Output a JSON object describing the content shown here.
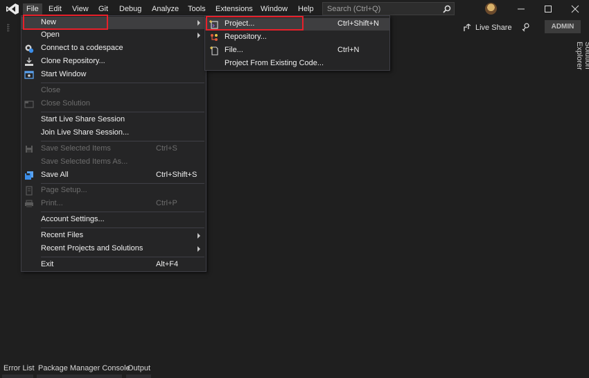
{
  "menubar": {
    "items": [
      "File",
      "Edit",
      "View",
      "Git",
      "Debug",
      "Analyze",
      "Tools",
      "Extensions",
      "Window",
      "Help"
    ],
    "search_placeholder": "Search (Ctrl+Q)"
  },
  "toolbar": {
    "live_share": "Live Share",
    "admin": "ADMIN"
  },
  "side_panel": {
    "solution_explorer": "Solution Explorer"
  },
  "file_menu": {
    "items": [
      {
        "label": "New",
        "shortcut": ""
      },
      {
        "label": "Open",
        "shortcut": ""
      },
      {
        "label": "Connect to a codespace",
        "shortcut": ""
      },
      {
        "label": "Clone Repository...",
        "shortcut": ""
      },
      {
        "label": "Start Window",
        "shortcut": ""
      },
      {
        "label": "Close",
        "shortcut": ""
      },
      {
        "label": "Close Solution",
        "shortcut": ""
      },
      {
        "label": "Start Live Share Session",
        "shortcut": ""
      },
      {
        "label": "Join Live Share Session...",
        "shortcut": ""
      },
      {
        "label": "Save Selected Items",
        "shortcut": "Ctrl+S"
      },
      {
        "label": "Save Selected Items As...",
        "shortcut": ""
      },
      {
        "label": "Save All",
        "shortcut": "Ctrl+Shift+S"
      },
      {
        "label": "Page Setup...",
        "shortcut": ""
      },
      {
        "label": "Print...",
        "shortcut": "Ctrl+P"
      },
      {
        "label": "Account Settings...",
        "shortcut": ""
      },
      {
        "label": "Recent Files",
        "shortcut": ""
      },
      {
        "label": "Recent Projects and Solutions",
        "shortcut": ""
      },
      {
        "label": "Exit",
        "shortcut": "Alt+F4"
      }
    ]
  },
  "new_submenu": {
    "items": [
      {
        "label": "Project...",
        "shortcut": "Ctrl+Shift+N"
      },
      {
        "label": "Repository...",
        "shortcut": ""
      },
      {
        "label": "File...",
        "shortcut": "Ctrl+N"
      },
      {
        "label": "Project From Existing Code...",
        "shortcut": ""
      }
    ]
  },
  "bottom_tabs": [
    "Error List",
    "Package Manager Console",
    "Output"
  ],
  "colors": {
    "background": "#1f1f1f",
    "menu_background": "#252526",
    "highlight": "#e8202a",
    "accent_purple": "#8661c5"
  }
}
